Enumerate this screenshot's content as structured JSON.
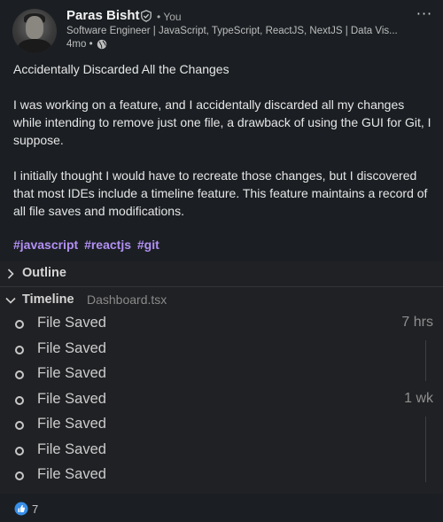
{
  "author": {
    "name": "Paras Bisht",
    "degree": "• You",
    "headline": "Software Engineer | JavaScript, TypeScript, ReactJS, NextJS | Data Vis...",
    "time": "4mo •"
  },
  "menu": {
    "more_label": "···"
  },
  "post": {
    "title": "Accidentally Discarded All the Changes",
    "paragraph1": "I was working on a feature, and I accidentally discarded all my changes while intending to remove just one file, a drawback of using the GUI for Git, I suppose.",
    "paragraph2": "I initially thought I would have to recreate those changes, but I discovered that most IDEs include a timeline feature. This feature maintains a record of all file saves and modifications.",
    "hashtags": [
      "#javascript",
      "#reactjs",
      "#git"
    ]
  },
  "ide": {
    "outline_label": "Outline",
    "timeline_label": "Timeline",
    "timeline_file": "Dashboard.tsx",
    "items": [
      {
        "label": "File Saved",
        "time": "7 hrs"
      },
      {
        "label": "File Saved",
        "time": ""
      },
      {
        "label": "File Saved",
        "time": ""
      },
      {
        "label": "File Saved",
        "time": "1 wk"
      },
      {
        "label": "File Saved",
        "time": ""
      },
      {
        "label": "File Saved",
        "time": ""
      },
      {
        "label": "File Saved",
        "time": ""
      }
    ]
  },
  "reactions": {
    "count": "7"
  },
  "colors": {
    "background": "#1b1f23",
    "hashtag": "#b390f4",
    "ide_background": "#202124"
  }
}
